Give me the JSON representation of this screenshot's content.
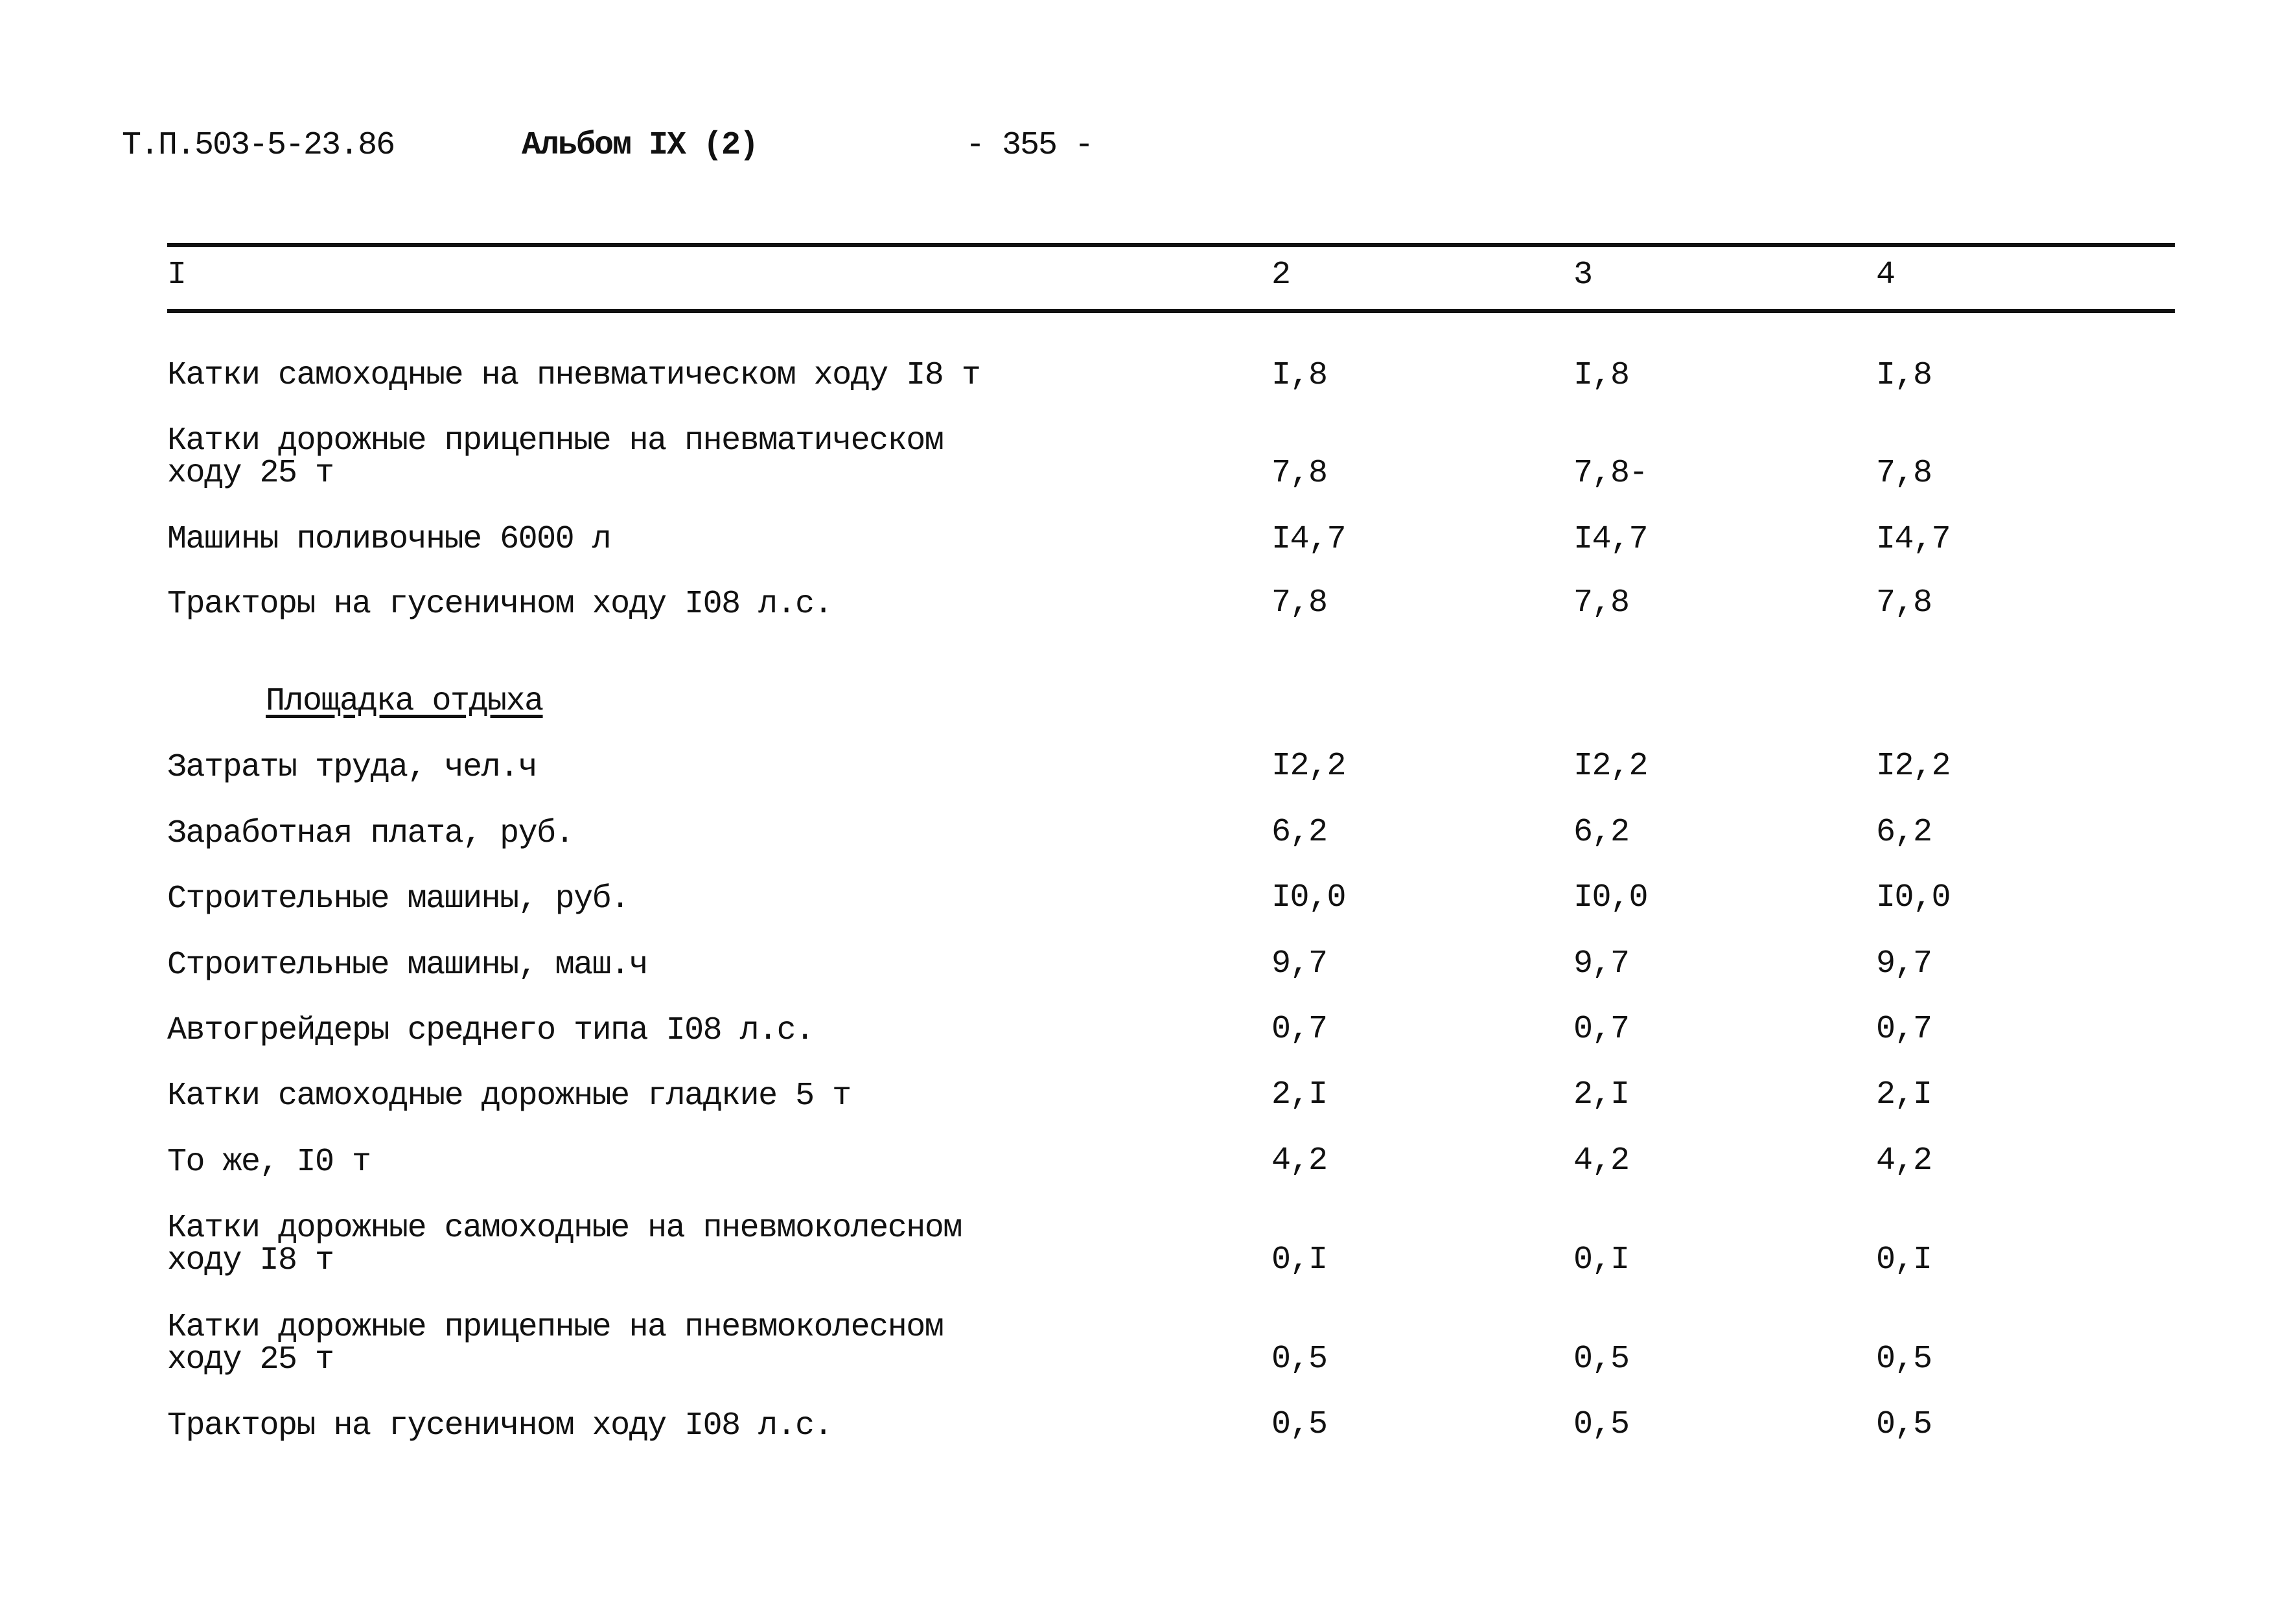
{
  "page_header": {
    "doc_code": "Т.П.503-5-23.86",
    "album": "Альбом IX (2)",
    "page_number": "- 355 -"
  },
  "table": {
    "columns": [
      "I",
      "2",
      "3",
      "4"
    ],
    "rows": [
      {
        "label": "Катки самоходные на пневматическом ходу I8 т",
        "values": [
          "I,8",
          "I,8",
          "I,8"
        ]
      },
      {
        "label": "Катки дорожные прицепные на пневматическом\nходу 25 т",
        "values": [
          "7,8",
          "7,8-",
          "7,8"
        ]
      },
      {
        "label": "Машины поливочные 6000 л",
        "values": [
          "I4,7",
          "I4,7",
          "I4,7"
        ]
      },
      {
        "label": "Тракторы на гусеничном ходу I08 л.с.",
        "values": [
          "7,8",
          "7,8",
          "7,8"
        ]
      }
    ],
    "section_title": "Площадка отдыха",
    "section_rows": [
      {
        "label": "Затраты труда, чел.ч",
        "values": [
          "I2,2",
          "I2,2",
          "I2,2"
        ]
      },
      {
        "label": "Заработная плата, руб.",
        "values": [
          "6,2",
          "6,2",
          "6,2"
        ]
      },
      {
        "label": "Строительные машины, руб.",
        "values": [
          "I0,0",
          "I0,0",
          "I0,0"
        ]
      },
      {
        "label": "Строительные машины, маш.ч",
        "values": [
          "9,7",
          "9,7",
          "9,7"
        ]
      },
      {
        "label": "Автогрейдеры среднего типа I08 л.с.",
        "values": [
          "0,7",
          "0,7",
          "0,7"
        ]
      },
      {
        "label": "Катки самоходные дорожные гладкие 5 т",
        "values": [
          "2,I",
          "2,I",
          "2,I"
        ]
      },
      {
        "label": "То же, I0 т",
        "values": [
          "4,2",
          "4,2",
          "4,2"
        ]
      },
      {
        "label": "Катки дорожные самоходные на пневмоколесном\nходу I8 т",
        "values": [
          "0,I",
          "0,I",
          "0,I"
        ]
      },
      {
        "label": "Катки дорожные прицепные на пневмоколесном\nходу 25 т",
        "values": [
          "0,5",
          "0,5",
          "0,5"
        ]
      },
      {
        "label": "Тракторы на гусеничном ходу I08 л.с.",
        "values": [
          "0,5",
          "0,5",
          "0,5"
        ]
      }
    ]
  }
}
